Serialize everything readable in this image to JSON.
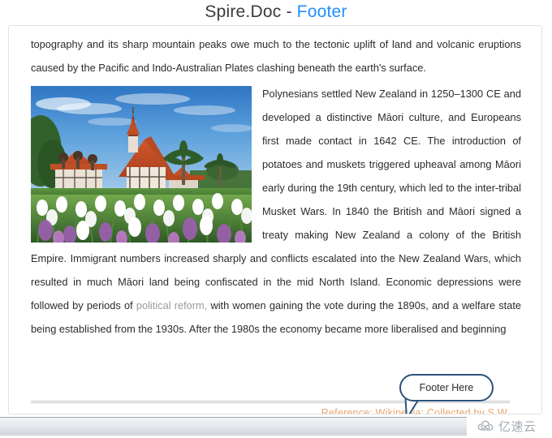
{
  "title": {
    "product": "Spire.Doc - ",
    "section": "Footer",
    "accent_color": "#1e90ff"
  },
  "document": {
    "paragraph_intro": "topography and its sharp mountain peaks owe much to the tectonic uplift of land and volcanic eruptions caused by the Pacific and Indo-Australian Plates clashing beneath the earth's surface.",
    "paragraph_body_part1": "Polynesians settled New Zealand in 1250–1300 CE and developed a distinctive Māori culture, and Europeans first made contact in 1642 CE. The introduction of potatoes and muskets triggered upheaval among Māori early during the 19th century, which led to the inter-tribal Musket Wars. In 1840 the British and Māori signed a treaty making New Zealand a colony of the British Empire. Immigrant numbers increased sharply and conflicts escalated into the New Zealand Wars, which resulted in much Māori land being confiscated in the mid North Island. Economic depressions were followed by periods of ",
    "paragraph_body_highlight": "political reform,",
    "paragraph_body_part2": " with women gaining the vote during the 1890s, and a welfare state being established from the 1930s. After the 1980s the economy became more liberalised and beginning",
    "image": {
      "alt": "Rotorua Museum Tudor-style building with white and purple tulip gardens under a blue sky"
    },
    "footer_separator": true,
    "footer_text": "Reference: Wikipedia; Collected by S.W.",
    "footer_text_color": "#e8a56c"
  },
  "callout": {
    "label": "Footer Here",
    "border_color": "#2d527c"
  },
  "watermark": {
    "text": "亿速云",
    "icon": "cloud-icon"
  }
}
